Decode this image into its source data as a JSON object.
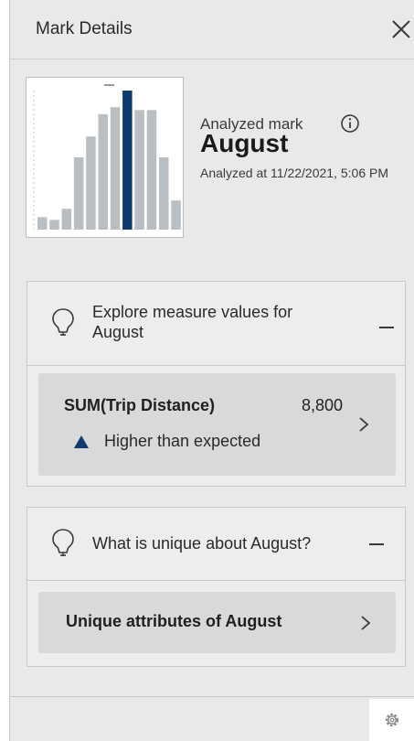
{
  "header": {
    "title": "Mark Details"
  },
  "mark": {
    "analyzed_label": "Analyzed mark",
    "name": "August",
    "analyzed_at": "Analyzed at 11/22/2021, 5:06 PM"
  },
  "thumbnail": {
    "bar_heights": [
      0.09,
      0.07,
      0.15,
      0.52,
      0.67,
      0.83,
      0.88,
      1.0,
      0.86,
      0.86,
      0.52,
      0.21
    ],
    "highlight_index": 7,
    "bar_color": "#b9bec3",
    "highlight_color": "#0f3a70"
  },
  "explore": {
    "title": "Explore measure values for August",
    "measure_name": "SUM(Trip Distance)",
    "measure_value": "8,800",
    "trend": "Higher than expected"
  },
  "unique": {
    "title": "What is unique about August?",
    "link": "Unique attributes of August"
  },
  "colors": {
    "accent": "#0f3a70",
    "panel": "#e9e9e9"
  }
}
